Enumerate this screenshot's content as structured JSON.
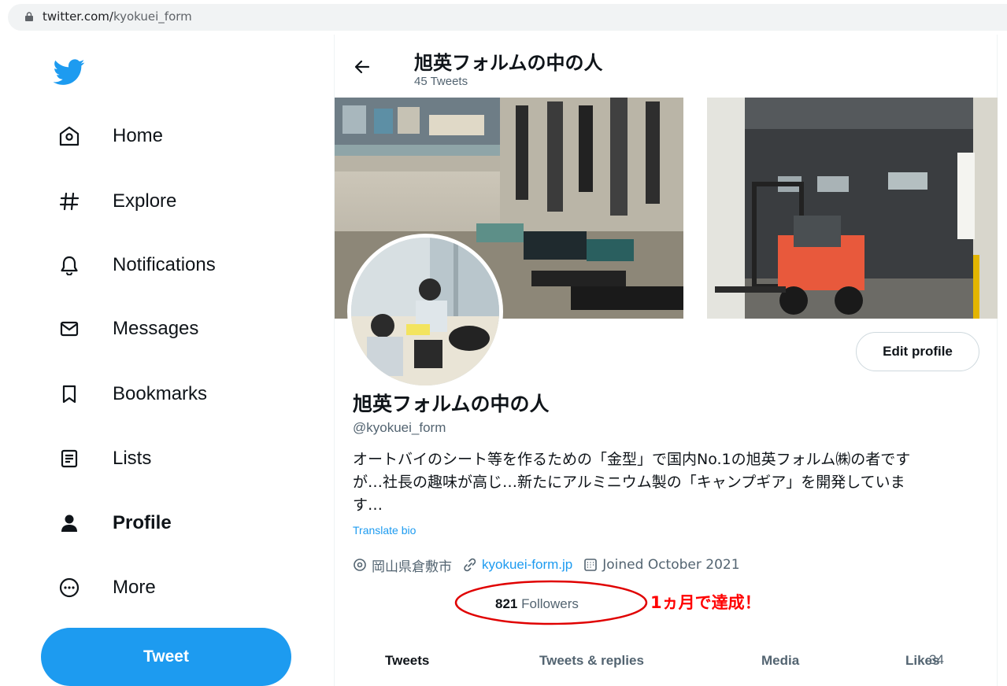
{
  "browser": {
    "url_host": "twitter.com/",
    "url_path": "kyokuei_form"
  },
  "nav": {
    "items": [
      {
        "label": "Home",
        "icon": "home-icon"
      },
      {
        "label": "Explore",
        "icon": "hashtag-icon"
      },
      {
        "label": "Notifications",
        "icon": "bell-icon"
      },
      {
        "label": "Messages",
        "icon": "envelope-icon"
      },
      {
        "label": "Bookmarks",
        "icon": "bookmark-icon"
      },
      {
        "label": "Lists",
        "icon": "list-icon"
      },
      {
        "label": "Profile",
        "icon": "person-icon"
      },
      {
        "label": "More",
        "icon": "more-circle-icon"
      }
    ],
    "tweet_button": "Tweet"
  },
  "header": {
    "name": "旭英フォルムの中の人",
    "tweet_count": "45 Tweets"
  },
  "profile": {
    "edit_button": "Edit profile",
    "name": "旭英フォルムの中の人",
    "handle": "@kyokuei_form",
    "bio_line1": "オートバイのシート等を作るための「金型」で国内No.1の旭英フォルム㈱の者です",
    "bio_line2": "が…社長の趣味が高じ…新たにアルミニウム製の「キャンプギア」を開発していま",
    "bio_line3": "す…",
    "translate_bio": "Translate bio",
    "location": "岡山県倉敷市",
    "website": "kyokuei-form.jp",
    "joined": "Joined October 2021",
    "followers_count": "821",
    "followers_label": "Followers"
  },
  "annotation": {
    "text": "1ヵ月で達成！",
    "color": "#ff0000"
  },
  "tabs": [
    "Tweets",
    "Tweets & replies",
    "Media",
    "Likes"
  ],
  "page_number": "34",
  "colors": {
    "accent": "#1d9bf0",
    "text": "#0f1419",
    "muted": "#536471"
  }
}
